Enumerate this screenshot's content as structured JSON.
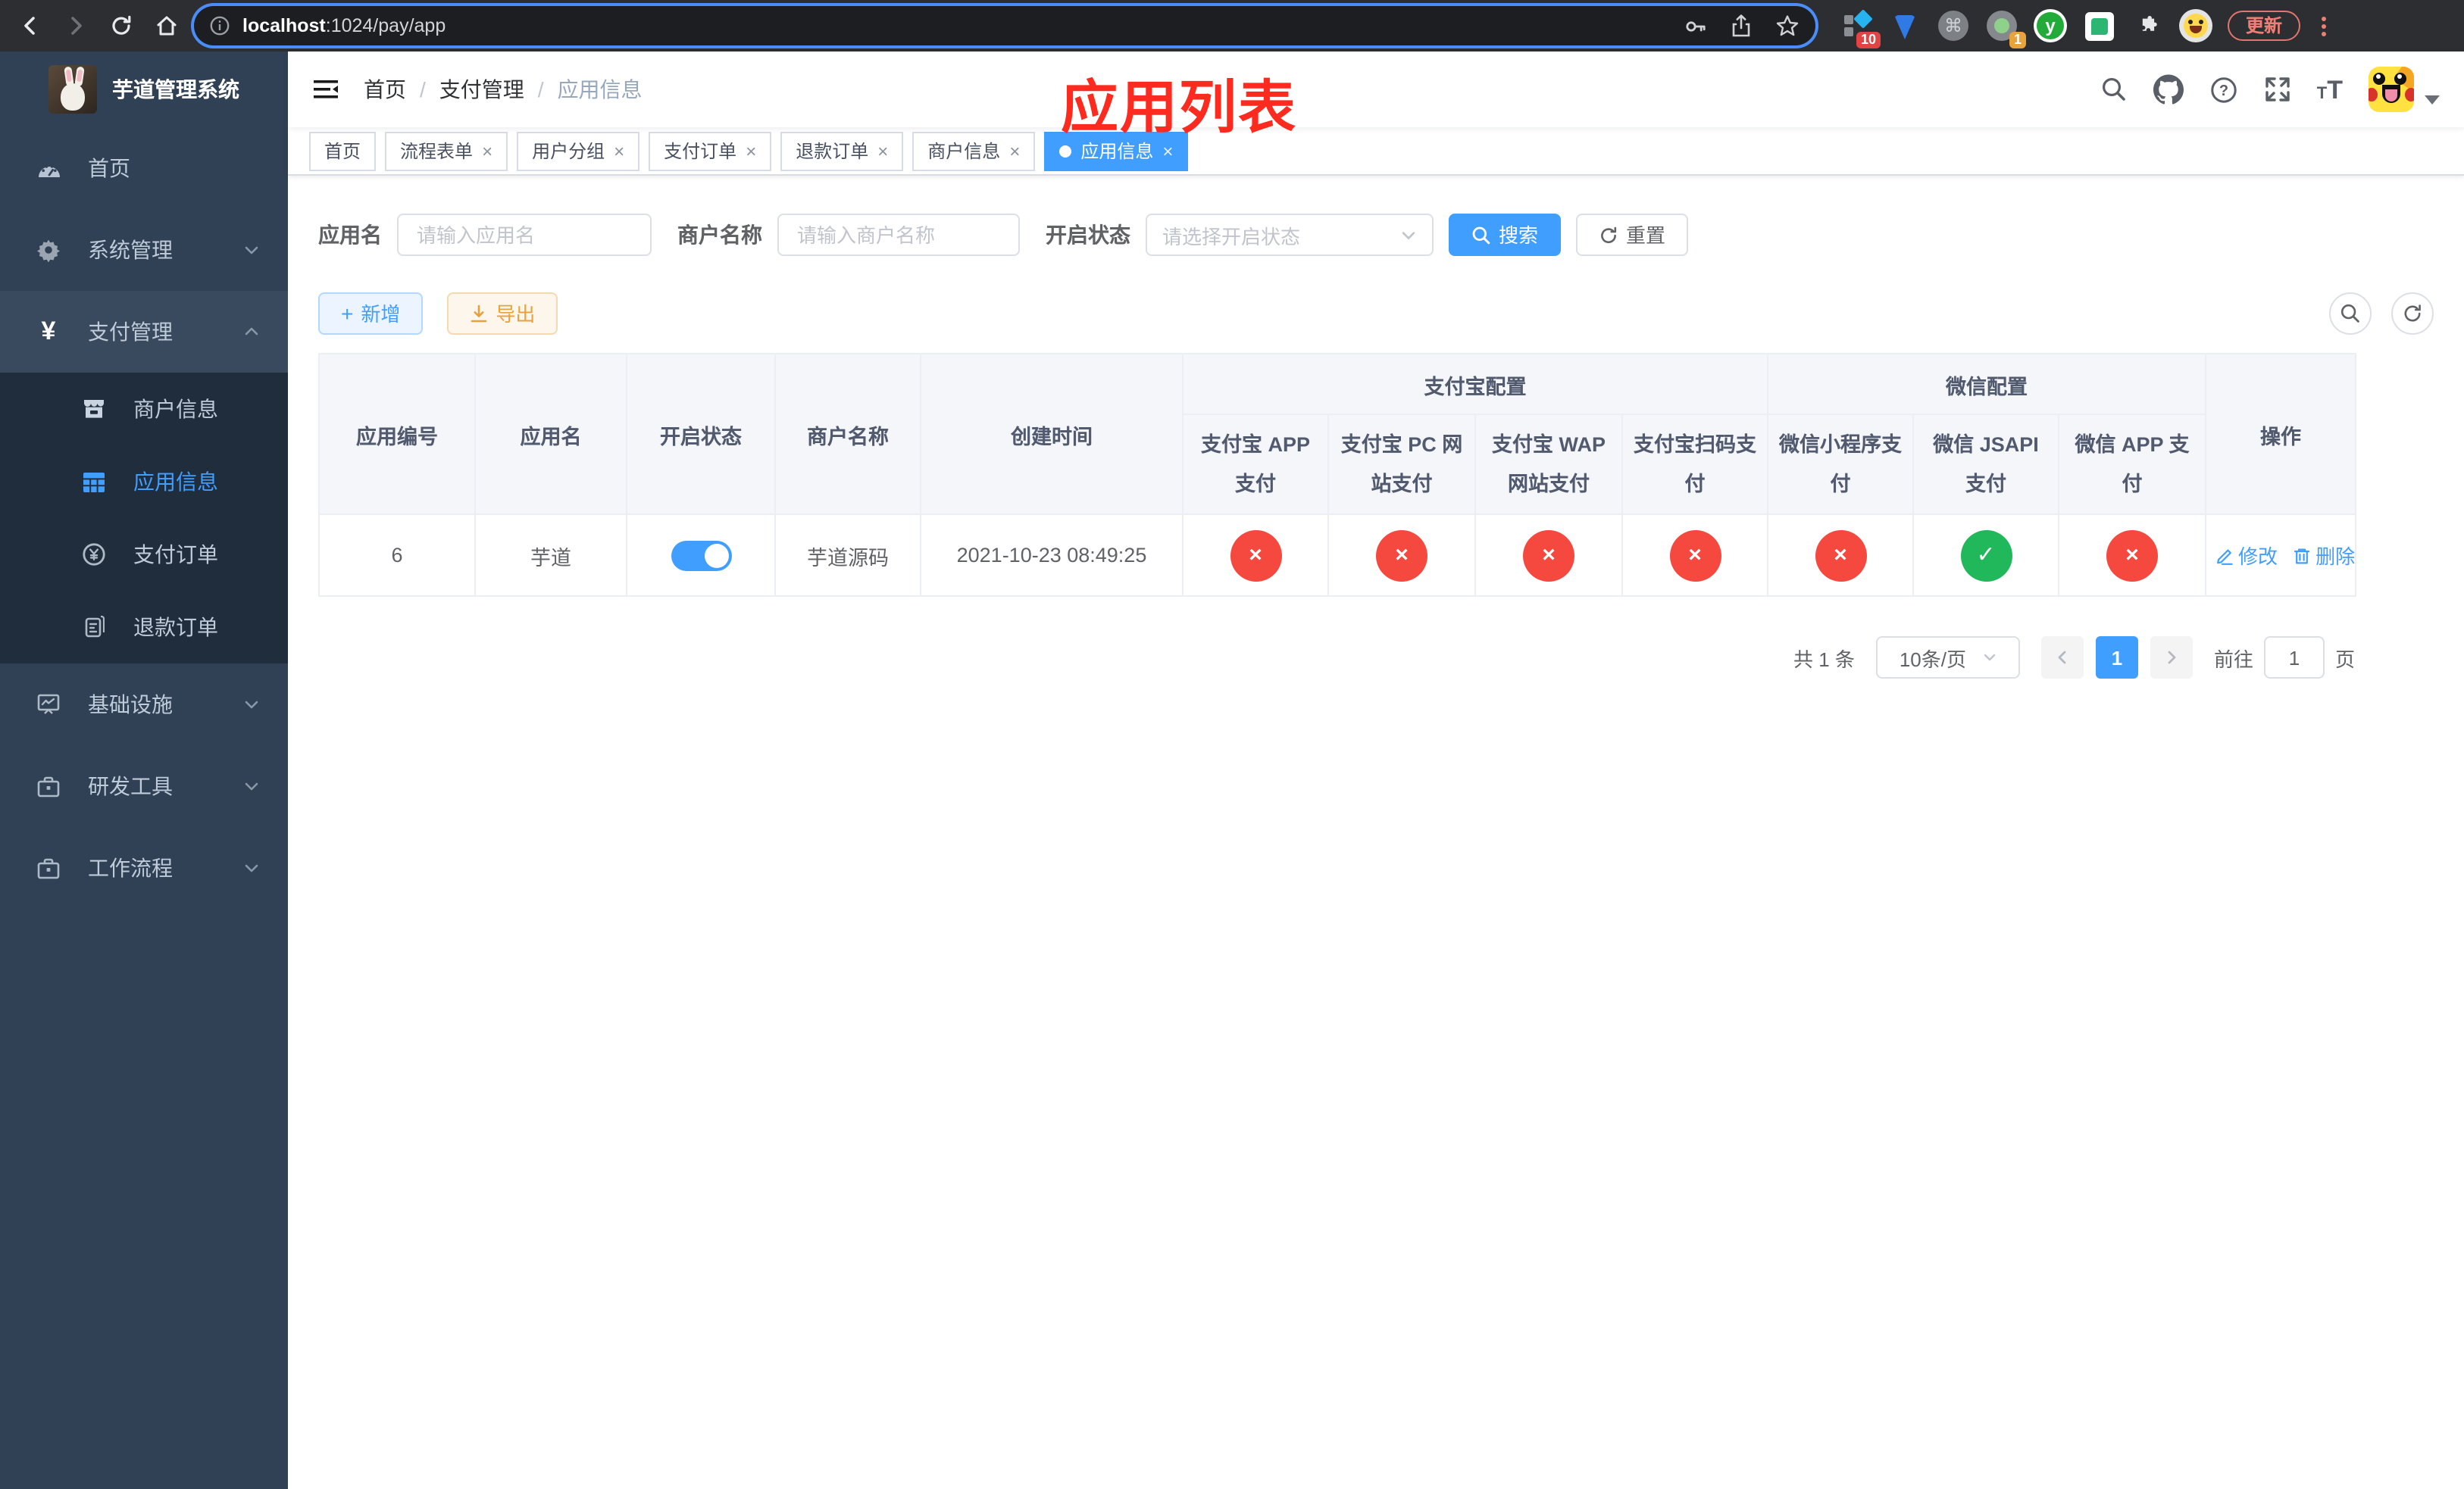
{
  "colors": {
    "accent": "#409eff",
    "danger": "#f5483f",
    "success": "#21b85c",
    "warning": "#e6a23c",
    "annotation_red": "#fd2b1f",
    "sidebar_bg": "#304156",
    "submenu_bg": "#1f2d3d"
  },
  "browser": {
    "url_host": "localhost",
    "url_rest": ":1024/pay/app",
    "ext_badge_10": "10",
    "ext_badge_1": "1",
    "ext_letter_y": "y",
    "cmd_glyph": "⌘",
    "update_label": "更新"
  },
  "sidebar": {
    "title": "芋道管理系统",
    "items": [
      {
        "label": "首页"
      },
      {
        "label": "系统管理"
      },
      {
        "label": "支付管理"
      },
      {
        "label": "基础设施"
      },
      {
        "label": "研发工具"
      },
      {
        "label": "工作流程"
      }
    ],
    "submenu": [
      {
        "label": "商户信息"
      },
      {
        "label": "应用信息"
      },
      {
        "label": "支付订单"
      },
      {
        "label": "退款订单"
      }
    ]
  },
  "header": {
    "breadcrumb": [
      {
        "label": "首页"
      },
      {
        "label": "支付管理"
      },
      {
        "label": "应用信息"
      }
    ],
    "separator": "/",
    "annotation": "应用列表"
  },
  "tabs": [
    {
      "label": "首页"
    },
    {
      "label": "流程表单"
    },
    {
      "label": "用户分组"
    },
    {
      "label": "支付订单"
    },
    {
      "label": "退款订单"
    },
    {
      "label": "商户信息"
    },
    {
      "label": "应用信息"
    }
  ],
  "filters": {
    "name_label": "应用名",
    "name_placeholder": "请输入应用名",
    "merchant_label": "商户名称",
    "merchant_placeholder": "请输入商户名称",
    "status_label": "开启状态",
    "status_placeholder": "请选择开启状态",
    "search_label": "搜索",
    "reset_label": "重置"
  },
  "toolbar": {
    "add_label": "新增",
    "export_label": "导出"
  },
  "table": {
    "col_id": "应用编号",
    "col_name": "应用名",
    "col_status": "开启状态",
    "col_merchant": "商户名称",
    "col_created": "创建时间",
    "group_alipay": "支付宝配置",
    "group_wechat": "微信配置",
    "col_alipay_app": "支付宝 APP 支付",
    "col_alipay_pc": "支付宝 PC 网站支付",
    "col_alipay_wap": "支付宝 WAP 网站支付",
    "col_alipay_qr": "支付宝扫码支付",
    "col_wx_mini": "微信小程序支付",
    "col_wx_jsapi": "微信 JSAPI 支付",
    "col_wx_app": "微信 APP 支付",
    "col_actions": "操作",
    "row": {
      "id": "6",
      "name": "芋道",
      "enabled": true,
      "merchant": "芋道源码",
      "created": "2021-10-23 08:49:25",
      "statuses": [
        "no",
        "no",
        "no",
        "no",
        "no",
        "yes",
        "no"
      ]
    },
    "action_edit": "修改",
    "action_delete": "删除"
  },
  "pagination": {
    "total": "共 1 条",
    "page_size": "10条/页",
    "current_page": "1",
    "goto_label": "前往",
    "goto_value": "1",
    "goto_unit": "页"
  }
}
